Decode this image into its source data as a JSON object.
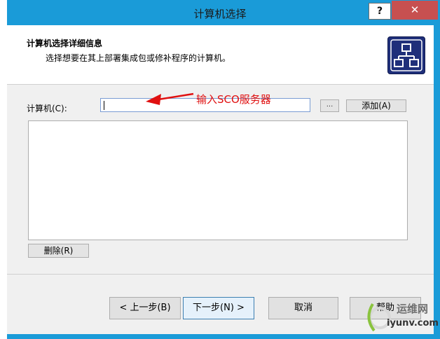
{
  "window": {
    "title": "计算机选择",
    "help_label": "?",
    "close_label": "✕"
  },
  "header": {
    "title": "计算机选择详细信息",
    "subtitle": "选择想要在其上部署集成包或修补程序的计算机。",
    "icon": "network-hierarchy-icon"
  },
  "form": {
    "computer_label": "计算机(C):",
    "computer_value": "",
    "browse_label": "...",
    "add_label": "添加(A)",
    "delete_label": "删除(R)"
  },
  "annotation": {
    "text": "输入SCO服务器",
    "color": "#e01010"
  },
  "footer": {
    "back_label": "< 上一步(B)",
    "next_label": "下一步(N) >",
    "cancel_label": "取消",
    "help_label": "帮助"
  },
  "watermark": {
    "line1": "运维网",
    "line2": "iyunv.com"
  },
  "colors": {
    "accent": "#1a9bd8",
    "close": "#c75050",
    "header_icon": "#1f2f7a"
  }
}
